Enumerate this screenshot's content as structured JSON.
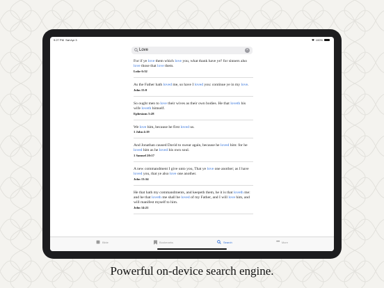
{
  "status_bar": {
    "time": "9:27 PM",
    "date": "Sat Apr 3",
    "battery": "100%"
  },
  "search": {
    "query": "Love",
    "clear_icon": "clear-icon"
  },
  "results": [
    {
      "verse": [
        {
          "t": "For if ye "
        },
        {
          "t": "love",
          "hl": true
        },
        {
          "t": " them which "
        },
        {
          "t": "love",
          "hl": true
        },
        {
          "t": " you, what thank have ye? for sinners also "
        },
        {
          "t": "love",
          "hl": true
        },
        {
          "t": " those that "
        },
        {
          "t": "love",
          "hl": true
        },
        {
          "t": " them."
        }
      ],
      "ref": "Luke 6:32"
    },
    {
      "verse": [
        {
          "t": "As the Father hath "
        },
        {
          "t": "loved",
          "hl": true
        },
        {
          "t": " me, so have I "
        },
        {
          "t": "loved",
          "hl": true
        },
        {
          "t": " you: continue ye in my "
        },
        {
          "t": "love",
          "hl": true
        },
        {
          "t": "."
        }
      ],
      "ref": "John 15:9"
    },
    {
      "verse": [
        {
          "t": "So ought men to "
        },
        {
          "t": "love",
          "hl": true
        },
        {
          "t": " their wives as their own bodies. He that "
        },
        {
          "t": "loveth",
          "hl": true
        },
        {
          "t": " his wife "
        },
        {
          "t": "loveth",
          "hl": true
        },
        {
          "t": " himself."
        }
      ],
      "ref": "Ephesians 5:28"
    },
    {
      "verse": [
        {
          "t": "We "
        },
        {
          "t": "love",
          "hl": true
        },
        {
          "t": " him, because he first "
        },
        {
          "t": "loved",
          "hl": true
        },
        {
          "t": " us."
        }
      ],
      "ref": "1 John 4:19"
    },
    {
      "verse": [
        {
          "t": "And Jonathan caused David to swear again, because he "
        },
        {
          "t": "loved",
          "hl": true
        },
        {
          "t": " him: for he "
        },
        {
          "t": "loved",
          "hl": true
        },
        {
          "t": " him as he "
        },
        {
          "t": "loved",
          "hl": true
        },
        {
          "t": " his own soul."
        }
      ],
      "ref": "1 Samuel 20:17"
    },
    {
      "verse": [
        {
          "t": "A new commandment I give unto you, That ye "
        },
        {
          "t": "love",
          "hl": true
        },
        {
          "t": " one another; as I have "
        },
        {
          "t": "loved",
          "hl": true
        },
        {
          "t": " you, that ye also "
        },
        {
          "t": "love",
          "hl": true
        },
        {
          "t": " one another."
        }
      ],
      "ref": "John 13:34"
    },
    {
      "verse": [
        {
          "t": "He that hath my commandments, and keepeth them, he it is that "
        },
        {
          "t": "loveth",
          "hl": true
        },
        {
          "t": " me: and he that "
        },
        {
          "t": "loveth",
          "hl": true
        },
        {
          "t": " me shall be "
        },
        {
          "t": "loved",
          "hl": true
        },
        {
          "t": " of my Father, and I will "
        },
        {
          "t": "love",
          "hl": true
        },
        {
          "t": " him, and will manifest myself to him."
        }
      ],
      "ref": "John 14:21"
    }
  ],
  "tabs": [
    {
      "label": "Bible",
      "icon": "book-icon",
      "active": false
    },
    {
      "label": "Bookmarks",
      "icon": "bookmark-icon",
      "active": false
    },
    {
      "label": "Search",
      "icon": "search-icon",
      "active": true
    },
    {
      "label": "More",
      "icon": "ellipsis-icon",
      "active": false
    }
  ],
  "caption": "Powerful on-device search engine.",
  "colors": {
    "highlight": "#2f6fd9",
    "background": "#f4f3ef",
    "device": "#1d1d1f"
  }
}
